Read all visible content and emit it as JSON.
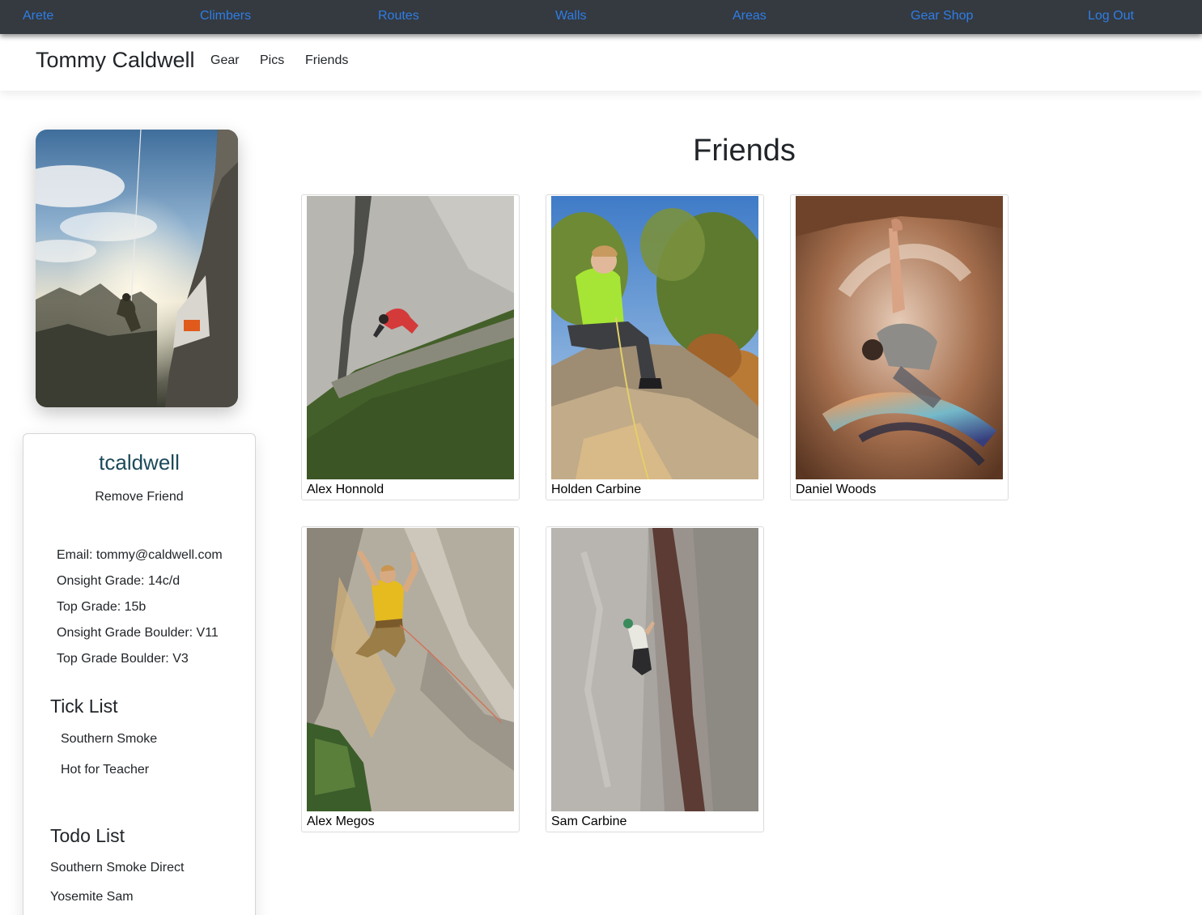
{
  "topnav": {
    "items": [
      "Arete",
      "Climbers",
      "Routes",
      "Walls",
      "Areas",
      "Gear Shop",
      "Log Out"
    ],
    "link_color": "#2f7de6",
    "background": "#343a40"
  },
  "header": {
    "title": "Tommy Caldwell",
    "tabs": [
      "Gear",
      "Pics",
      "Friends"
    ]
  },
  "profile": {
    "username": "tcaldwell",
    "remove_label": "Remove Friend",
    "info": [
      "Email: tommy@caldwell.com",
      "Onsight Grade: 14c/d",
      "Top Grade: 15b",
      "Onsight Grade Boulder: V11",
      "Top Grade Boulder: V3"
    ],
    "tick_title": "Tick List",
    "tick_list": [
      "Southern Smoke",
      "Hot for Teacher"
    ],
    "todo_title": "Todo List",
    "todo_list": [
      "Southern Smoke Direct",
      "Yosemite Sam"
    ]
  },
  "friends": {
    "title": "Friends",
    "items": [
      {
        "name": "Alex Honnold"
      },
      {
        "name": "Holden Carbine"
      },
      {
        "name": "Daniel Woods"
      },
      {
        "name": "Alex Megos"
      },
      {
        "name": "Sam Carbine"
      }
    ]
  }
}
